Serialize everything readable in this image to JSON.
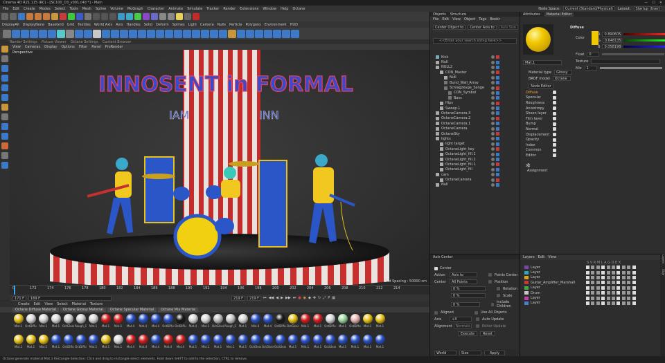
{
  "window": {
    "title": "Cinema 4D R21.115 (RC) - [SC100_D3_v001.c4d *] - Main"
  },
  "menubar": {
    "items": [
      "File",
      "Edit",
      "Create",
      "Modes",
      "Select",
      "Tools",
      "Mesh",
      "Spline",
      "Volume",
      "MoGraph",
      "Character",
      "Animate",
      "Simulate",
      "Tracker",
      "Render",
      "Extensions",
      "Window",
      "Help",
      "Octane"
    ],
    "node_space_label": "Node Space:",
    "node_space_value": "Current (Standard/Physical)",
    "layout_label": "Layout:",
    "layout_value": "Startup (User)"
  },
  "toolbar2": {
    "items": [
      "DisplayAll",
      "DisplayNone",
      "BaseGrid",
      "Grid",
      "Textiles",
      "World Axis",
      "Axis",
      "Handles",
      "Solid",
      "Deform",
      "Splines",
      "Light",
      "Camera",
      "Nulls",
      "Particle",
      "Polygons",
      "Environment",
      "HUD"
    ]
  },
  "toolbar4": {
    "items": [
      "Render Settings",
      "Picture Viewer",
      "Octane Settings",
      "Content Browser"
    ]
  },
  "viewport": {
    "menu": [
      "View",
      "Cameras",
      "Display",
      "Options",
      "Filter",
      "Panel",
      "ProRender"
    ],
    "label": "Perspective",
    "sign_text": "INNOSENT in FORMAL",
    "grid_spacing": "Grid Spacing : 50000 cm"
  },
  "timeline": {
    "ticks": [
      "0",
      "172",
      "174",
      "176",
      "178",
      "180",
      "182",
      "184",
      "186",
      "188",
      "190",
      "192",
      "194",
      "196",
      "198",
      "200",
      "202",
      "204",
      "206",
      "208",
      "210",
      "212",
      "214"
    ],
    "start_field": "171 F",
    "current_frame": "169 F",
    "end_field": "219 F",
    "end_field2": "219 F",
    "right_field": "169 F",
    "right_field2": "214"
  },
  "material_manager": {
    "menu": [
      "Create",
      "Edit",
      "View",
      "Select",
      "Material",
      "Texture"
    ],
    "tabs": [
      "Octane Diffuse Material",
      "Octane Glossy Material",
      "Octane Specular Material",
      "Octane Mix Material"
    ],
    "row1": [
      {
        "label": "Mat.1",
        "color": "#e8c21a"
      },
      {
        "label": "OctDiffu",
        "color": "#d8d8d8"
      },
      {
        "label": "Mat.1",
        "color": "#d8d8d8"
      },
      {
        "label": "Mat.1",
        "color": "#d8d8d8"
      },
      {
        "label": "OctGloss",
        "color": "#cfcfcf"
      },
      {
        "label": "Rough_G",
        "color": "#d0d0d0"
      },
      {
        "label": "Mat.1",
        "color": "#d8d8d8"
      },
      {
        "label": "Mat.1",
        "color": "#d42020"
      },
      {
        "label": "Mat.1",
        "color": "#d42020"
      },
      {
        "label": "Mat.4",
        "color": "#2a52c8"
      },
      {
        "label": "Mat.4",
        "color": "#2a52c8"
      },
      {
        "label": "Mat.4",
        "color": "#2a52c8"
      },
      {
        "label": "OctDiffu",
        "color": "#2a52c8"
      },
      {
        "label": "OctDiffu",
        "color": "#1a1a1a"
      },
      {
        "label": "Mat.4",
        "color": "#d8d8d8"
      },
      {
        "label": "Mat.1",
        "color": "#d8d8d8"
      },
      {
        "label": "OctGloss",
        "color": "#bdbdbd"
      },
      {
        "label": "Rough_G",
        "color": "#c8c8c8"
      },
      {
        "label": "Mat.1",
        "color": "#d8d8d8"
      },
      {
        "label": "Mat.4",
        "color": "#2a52c8"
      },
      {
        "label": "Mat.4",
        "color": "#2a52c8"
      },
      {
        "label": "OctDiffu",
        "color": "#1a1a1a"
      },
      {
        "label": "OctGloss",
        "color": "#e8c21a"
      },
      {
        "label": "Mat.1",
        "color": "#d42020"
      },
      {
        "label": "Mat.1",
        "color": "#d42020"
      },
      {
        "label": "OctDiffu",
        "color": "#d8d8d8"
      },
      {
        "label": "Mat.1",
        "color": "#9ed8a0"
      },
      {
        "label": "OctDiffu",
        "color": "#e8b4b4"
      },
      {
        "label": "Mat.1",
        "color": "#e8c21a"
      },
      {
        "label": "Mat.1",
        "color": "#e8c21a"
      }
    ],
    "row2": [
      {
        "label": "Mat.1",
        "color": "#e8c21a"
      },
      {
        "label": "Mat.1",
        "color": "#e8c21a"
      },
      {
        "label": "Mat.1",
        "color": "#e8c21a"
      },
      {
        "label": "Mat.1",
        "color": "#2a52c8"
      },
      {
        "label": "OctDiffu",
        "color": "#2a52c8"
      },
      {
        "label": "OctDiffu",
        "color": "#2a52c8"
      },
      {
        "label": "Mat.1",
        "color": "#2a52c8"
      },
      {
        "label": "Mat.1",
        "color": "#e8c21a"
      },
      {
        "label": "Mat.1",
        "color": "#d8d8d8"
      },
      {
        "label": "Mat.4",
        "color": "#d42020"
      },
      {
        "label": "Mat.4",
        "color": "#d42020"
      },
      {
        "label": "Mat.4",
        "color": "#2a52c8"
      },
      {
        "label": "Mat.4",
        "color": "#d42020"
      },
      {
        "label": "Mat.4",
        "color": "#d42020"
      },
      {
        "label": "Mat.1",
        "color": "#2a52c8"
      },
      {
        "label": "Mat.1",
        "color": "#2a52c8"
      },
      {
        "label": "Mat.1",
        "color": "#2a52c8"
      },
      {
        "label": "Mat.1",
        "color": "#2a52c8"
      },
      {
        "label": "Mat.1",
        "color": "#2a52c8"
      },
      {
        "label": "OctGloss",
        "color": "#2a52c8"
      },
      {
        "label": "OctGloss",
        "color": "#2a52c8"
      },
      {
        "label": "OctGloss",
        "color": "#2a52c8"
      },
      {
        "label": "Mat.1",
        "color": "#2a52c8"
      },
      {
        "label": "Mat.1",
        "color": "#2a52c8"
      },
      {
        "label": "Mat.1",
        "color": "#2a52c8"
      },
      {
        "label": "OctGloss",
        "color": "#2a52c8"
      },
      {
        "label": "Mat.1",
        "color": "#2a52c8"
      },
      {
        "label": "Mat.1",
        "color": "#2a52c8"
      },
      {
        "label": "Mat.1",
        "color": "#2a52c8"
      },
      {
        "label": "Mat.1",
        "color": "#2a52c8"
      }
    ]
  },
  "statusbar": {
    "text": "Octane:generate material:Mat.1     Rectangle Selection: Click and drag to rectangle-select elements. Hold down SHIFT to add to the selection, CTRL to remove."
  },
  "objects_panel": {
    "tabs": [
      "Objects",
      "Structure"
    ],
    "menu": [
      "File",
      "Edit",
      "View",
      "Object",
      "Tags",
      "Bookr"
    ],
    "buttons": [
      "Center Object to",
      "Center Axis to",
      "Axis Size"
    ],
    "search_placeholder": "<<Enter your search string here>>",
    "rows": [
      {
        "name": "Kick",
        "indent": 1,
        "c": "#7ab"
      },
      {
        "name": "Null",
        "indent": 1,
        "c": "#aaa"
      },
      {
        "name": "NULL2",
        "indent": 1,
        "c": "#aaa"
      },
      {
        "name": "CON_Master",
        "indent": 2,
        "c": "#aaa"
      },
      {
        "name": "Null",
        "indent": 3,
        "c": "#aaa"
      },
      {
        "name": "Bund_Wall_Array",
        "indent": 3,
        "c": "#777"
      },
      {
        "name": "Schlagzeuge_Sange",
        "indent": 3,
        "c": "#777"
      },
      {
        "name": "CON_Symbol",
        "indent": 4,
        "c": "#777"
      },
      {
        "name": "Bass",
        "indent": 4,
        "c": "#777"
      },
      {
        "name": "Hips",
        "indent": 2,
        "c": "#aaa"
      },
      {
        "name": "Sweep.1",
        "indent": 2,
        "c": "#aaa"
      },
      {
        "name": "OctaneCamera.3",
        "indent": 1,
        "c": "#aaa"
      },
      {
        "name": "OctaneCamera.2",
        "indent": 1,
        "c": "#aaa"
      },
      {
        "name": "OctaneCamera.1",
        "indent": 1,
        "c": "#aaa"
      },
      {
        "name": "OctaneCamera",
        "indent": 1,
        "c": "#aaa"
      },
      {
        "name": "OctaneSky",
        "indent": 1,
        "c": "#aaa"
      },
      {
        "name": "lights",
        "indent": 1,
        "c": "#aaa"
      },
      {
        "name": "light target",
        "indent": 2,
        "c": "#aaa"
      },
      {
        "name": "OctaneLight_key",
        "indent": 2,
        "c": "#aaa"
      },
      {
        "name": "OctaneLight_fill.1",
        "indent": 2,
        "c": "#aaa"
      },
      {
        "name": "OctaneLight_fill.2",
        "indent": 2,
        "c": "#aaa"
      },
      {
        "name": "OctaneLight_fill.1",
        "indent": 2,
        "c": "#aaa"
      },
      {
        "name": "OctaneLight_fill",
        "indent": 2,
        "c": "#aaa"
      },
      {
        "name": "cam",
        "indent": 1,
        "c": "#aaa"
      },
      {
        "name": "OctaneCamera",
        "indent": 2,
        "c": "#aaa"
      },
      {
        "name": "Null",
        "indent": 1,
        "c": "#aaa"
      }
    ]
  },
  "attributes": {
    "tabs": [
      "Attributes",
      "Material Editor"
    ],
    "mat_name": "Mat.1",
    "material_type_label": "Material type",
    "material_type_value": "Glossy",
    "brdf_label": "BRDF model",
    "brdf_value": "Octane",
    "node_editor": "Node Editor",
    "channels": [
      "Diffuse",
      "Specular",
      "Roughness",
      "Anisotropy",
      "Sheen layer",
      "Film layer",
      "Bump",
      "Normal",
      "Displacement",
      "Opacity",
      "Index",
      "Common",
      "Editor"
    ],
    "assignment": "Assignment",
    "diffuse_title": "Diffuse",
    "color_label": "Color",
    "r_label": "R",
    "r_value": "0.890605",
    "g_label": "G",
    "g_value": "0.648135",
    "b_label": "B",
    "b_value": "0.058198",
    "float_label": "Float",
    "float_value": "0",
    "texture_label": "Texture",
    "mix_label": "Mix",
    "mix_value": "1",
    "swatch_color": "#f2c800"
  },
  "axis_center": {
    "title": "Axis Center",
    "center_label": "Center",
    "action_label": "Action",
    "action_value": "Axis to",
    "center2_label": "Center",
    "center2_value": "All Points",
    "points_center_label": "Points Center",
    "position_label": "Position",
    "rotation_label": "Rotation",
    "scale_label": "Scale",
    "include_children": "Include Children",
    "use_all_objects": "Use All Objects",
    "auto_update": "Auto Update",
    "editor_update": "Editor Update",
    "aligned_label": "Aligned",
    "axis_label": "Axis",
    "axis_value": "+X",
    "alignment_label": "Alignment",
    "alignment_value": "Normals",
    "percent": "0 %",
    "execute": "Execute",
    "reset": "Reset",
    "world": "World",
    "size": "Size",
    "apply": "Apply"
  },
  "layers": {
    "menu": [
      "Layers",
      "Edit",
      "View"
    ],
    "header": "S V R M L A G D E X",
    "side_tabs": [
      "Layers",
      "Obje"
    ],
    "rows": [
      {
        "name": "Layer",
        "c": "#7a48a8"
      },
      {
        "name": "Layer",
        "c": "#2aa8c8"
      },
      {
        "name": "Layer",
        "c": "#e0a020"
      },
      {
        "name": "Guitar_Amplifier_Marshall",
        "c": "#c83a3a"
      },
      {
        "name": "Layer",
        "c": "#48a848"
      },
      {
        "name": "Drum",
        "c": "#c8c8c8"
      },
      {
        "name": "Layer",
        "c": "#c83aa8"
      },
      {
        "name": "Layer",
        "c": "#4880c8"
      }
    ]
  }
}
